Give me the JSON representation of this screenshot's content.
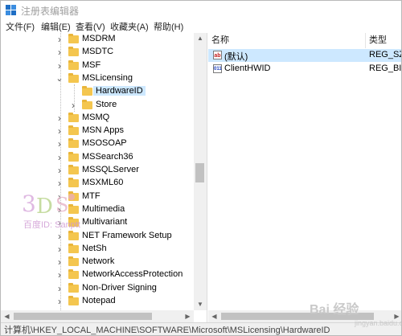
{
  "window": {
    "title": "注册表编辑器"
  },
  "menu": [
    {
      "label": "文件(F)"
    },
    {
      "label": "编辑(E)"
    },
    {
      "label": "查看(V)"
    },
    {
      "label": "收藏夹(A)"
    },
    {
      "label": "帮助(H)"
    }
  ],
  "tree": [
    {
      "label": "MSDRM",
      "expanded": false,
      "selected": false
    },
    {
      "label": "MSDTC",
      "expanded": false,
      "selected": false
    },
    {
      "label": "MSF",
      "expanded": false,
      "selected": false
    },
    {
      "label": "MSLicensing",
      "expanded": true,
      "selected": false
    },
    {
      "label": "HardwareID",
      "expanded": false,
      "selected": true
    },
    {
      "label": "Store",
      "expanded": false,
      "selected": false
    },
    {
      "label": "MSMQ",
      "expanded": false,
      "selected": false
    },
    {
      "label": "MSN Apps",
      "expanded": false,
      "selected": false
    },
    {
      "label": "MSOSOAP",
      "expanded": false,
      "selected": false
    },
    {
      "label": "MSSearch36",
      "expanded": false,
      "selected": false
    },
    {
      "label": "MSSQLServer",
      "expanded": false,
      "selected": false
    },
    {
      "label": "MSXML60",
      "expanded": false,
      "selected": false
    },
    {
      "label": "MTF",
      "expanded": false,
      "selected": false
    },
    {
      "label": "Multimedia",
      "expanded": false,
      "selected": false
    },
    {
      "label": "Multivariant",
      "expanded": false,
      "selected": false
    },
    {
      "label": "NET Framework Setup",
      "expanded": false,
      "selected": false
    },
    {
      "label": "NetSh",
      "expanded": false,
      "selected": false
    },
    {
      "label": "Network",
      "expanded": false,
      "selected": false
    },
    {
      "label": "NetworkAccessProtection",
      "expanded": false,
      "selected": false
    },
    {
      "label": "Non-Driver Signing",
      "expanded": false,
      "selected": false
    },
    {
      "label": "Notepad",
      "expanded": false,
      "selected": false
    }
  ],
  "list": {
    "columns": [
      "名称",
      "类型"
    ],
    "rows": [
      {
        "name": "(默认)",
        "type": "REG_SZ",
        "icon": "ab",
        "selected": true
      },
      {
        "name": "ClientHWID",
        "type": "REG_BI",
        "icon": "011",
        "selected": false
      }
    ]
  },
  "status": "计算机\\HKEY_LOCAL_MACHINE\\SOFTWARE\\Microsoft\\MSLicensing\\HardwareID",
  "watermark": {
    "text": "百度ID: Sanptt"
  },
  "corner_mark": {
    "text": "Bai 经验",
    "sub": "jingyan.baidu.com"
  },
  "colors": {
    "selection": "#cde8ff",
    "folder": "#f4c64f",
    "titlebar_icon": "#1f6fc5"
  }
}
